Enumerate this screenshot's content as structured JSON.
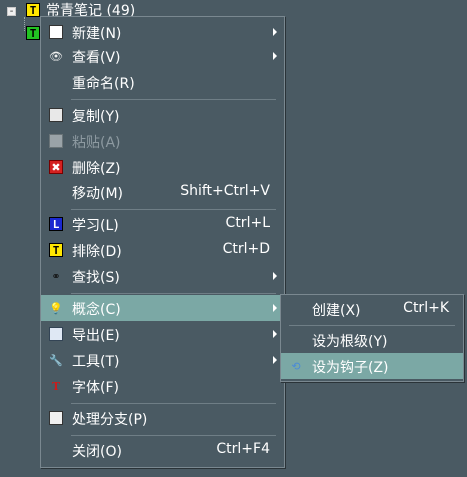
{
  "tree": {
    "root_label": "常青笔记 (49)",
    "root_icon": "T",
    "child_icon": "T"
  },
  "context_menu": {
    "items": [
      {
        "label": "新建(N)",
        "shortcut": "",
        "icon": "new-doc-icon",
        "submenu": true
      },
      {
        "label": "查看(V)",
        "shortcut": "",
        "icon": "eye-icon",
        "submenu": true
      },
      {
        "label": "重命名(R)",
        "shortcut": "",
        "icon": "",
        "submenu": false
      },
      {
        "label": "复制(Y)",
        "shortcut": "",
        "icon": "copy-icon",
        "submenu": false
      },
      {
        "label": "粘贴(A)",
        "shortcut": "",
        "icon": "paste-icon",
        "submenu": false,
        "disabled": true
      },
      {
        "label": "删除(Z)",
        "shortcut": "",
        "icon": "delete-icon",
        "submenu": false
      },
      {
        "label": "移动(M)",
        "shortcut": "Shift+Ctrl+V",
        "icon": "",
        "submenu": false
      },
      {
        "label": "学习(L)",
        "shortcut": "Ctrl+L",
        "icon": "learn-icon",
        "submenu": false
      },
      {
        "label": "排除(D)",
        "shortcut": "Ctrl+D",
        "icon": "exclude-icon",
        "submenu": false
      },
      {
        "label": "查找(S)",
        "shortcut": "",
        "icon": "binoculars-icon",
        "submenu": true
      },
      {
        "label": "概念(C)",
        "shortcut": "",
        "icon": "lightbulb-icon",
        "submenu": true,
        "highlighted": true
      },
      {
        "label": "导出(E)",
        "shortcut": "",
        "icon": "export-icon",
        "submenu": true
      },
      {
        "label": "工具(T)",
        "shortcut": "",
        "icon": "wrench-icon",
        "submenu": true
      },
      {
        "label": "字体(F)",
        "shortcut": "",
        "icon": "font-icon",
        "submenu": false
      },
      {
        "label": "处理分支(P)",
        "shortcut": "",
        "icon": "branch-icon",
        "submenu": false
      },
      {
        "label": "关闭(O)",
        "shortcut": "Ctrl+F4",
        "icon": "",
        "submenu": false
      }
    ],
    "icon_glyphs": {
      "eye": "👁",
      "binoculars": "⚭",
      "lightbulb": "💡",
      "wrench": "🔧",
      "font": "T",
      "delete": "✖",
      "learn": "L",
      "exclude": "T"
    }
  },
  "submenu": {
    "items": [
      {
        "label": "创建(X)",
        "shortcut": "Ctrl+K",
        "icon": ""
      },
      {
        "label": "设为根级(Y)",
        "shortcut": "",
        "icon": ""
      },
      {
        "label": "设为钩子(Z)",
        "shortcut": "",
        "icon": "hook-icon",
        "highlighted": true
      }
    ],
    "hook_glyph": "⟲"
  },
  "colors": {
    "background": "#4a5a63",
    "highlight": "#7ba8a5",
    "text": "#ffffff",
    "disabled_text": "#8d9aa1"
  }
}
